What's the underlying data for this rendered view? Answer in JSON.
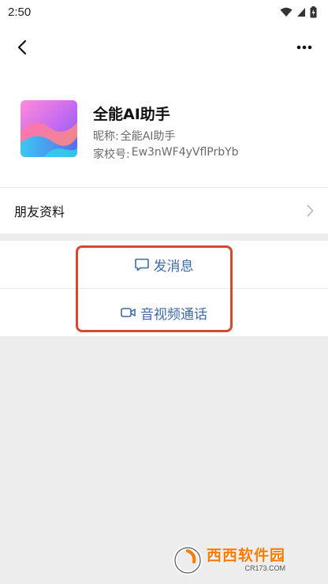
{
  "status_bar": {
    "time": "2:50"
  },
  "profile": {
    "name": "全能AI助手",
    "nickname_label": "昵称:",
    "nickname_value": "全能AI助手",
    "school_id_label": "家校号:",
    "school_id_value": "Ew3nWF4yVflPrbYb"
  },
  "menu": {
    "friend_info_label": "朋友资料"
  },
  "actions": {
    "message_label": "发消息",
    "video_call_label": "音视频通话"
  },
  "watermark": {
    "title": "西西软件园",
    "sub": "CR173.COM"
  },
  "colors": {
    "accent_link": "#3d6aa8",
    "highlight": "#d34a2e",
    "background": "#ededed"
  },
  "icons": {
    "back": "chevron-left-icon",
    "more": "more-dots-icon",
    "message": "chat-bubble-icon",
    "video": "video-camera-icon",
    "arrow": "chevron-right-icon"
  }
}
